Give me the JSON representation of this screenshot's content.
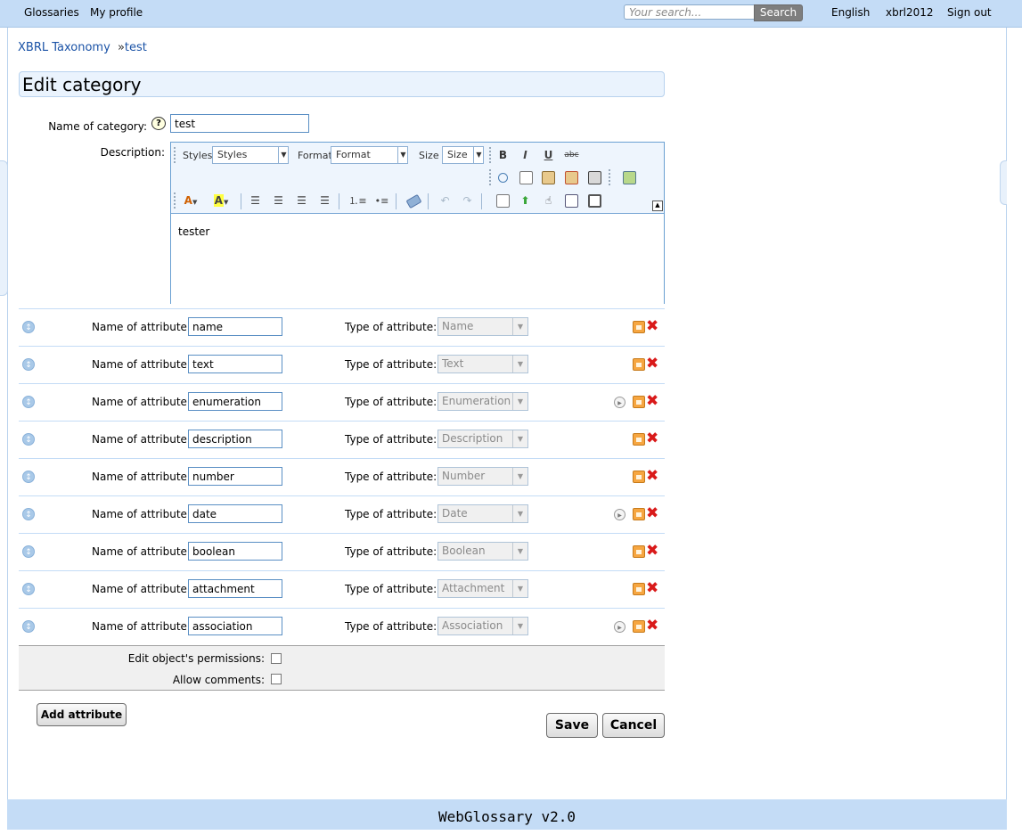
{
  "topbar": {
    "nav_glossaries": "Glossaries",
    "nav_profile": "My profile",
    "search_placeholder": "Your search...",
    "search_button": "Search",
    "language": "English",
    "username": "xbrl2012",
    "sign_out": "Sign out"
  },
  "breadcrumb": {
    "root": "XBRL Taxonomy",
    "sep": "»",
    "current": "test"
  },
  "page_title": "Edit category",
  "form": {
    "name_label": "Name of category:",
    "name_value": "test",
    "description_label": "Description:",
    "description_text": "tester"
  },
  "editor": {
    "styles_label": "Styles",
    "styles_value": "Styles",
    "format_label": "Format",
    "format_value": "Format",
    "size_label": "Size",
    "size_value": "Size",
    "bold": "B",
    "italic": "I",
    "underline": "U",
    "strike": "abc",
    "font_color": "A",
    "bg_color": "A"
  },
  "attributes": {
    "name_label": "Name of attribute:",
    "type_label": "Type of attribute:",
    "rows": [
      {
        "name": "name",
        "type": "Name",
        "has_options": false
      },
      {
        "name": "text",
        "type": "Text",
        "has_options": false
      },
      {
        "name": "enumeration",
        "type": "Enumeration",
        "has_options": true
      },
      {
        "name": "description",
        "type": "Description",
        "has_options": false
      },
      {
        "name": "number",
        "type": "Number",
        "has_options": false
      },
      {
        "name": "date",
        "type": "Date",
        "has_options": true
      },
      {
        "name": "boolean",
        "type": "Boolean",
        "has_options": false
      },
      {
        "name": "attachment",
        "type": "Attachment",
        "has_options": false
      },
      {
        "name": "association",
        "type": "Association",
        "has_options": true
      }
    ]
  },
  "options": {
    "permissions_label": "Edit object's permissions:",
    "comments_label": "Allow comments:"
  },
  "buttons": {
    "add_attribute": "Add attribute",
    "save": "Save",
    "cancel": "Cancel"
  },
  "footer": "WebGlossary v2.0",
  "colors": {
    "topbar": "#c4dcf6",
    "link": "#1a52a6",
    "delete": "#d91a1a",
    "lock": "#f6a641"
  }
}
